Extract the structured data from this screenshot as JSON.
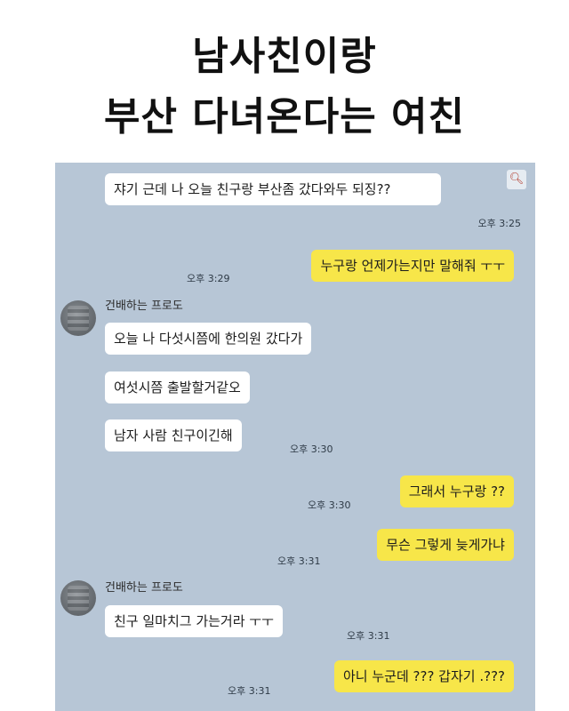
{
  "headline": {
    "line1": "남사친이랑",
    "line2": "부산 다녀온다는 여친"
  },
  "chat": {
    "search_icon": "search-icon",
    "messages": [
      {
        "side": "left",
        "text": "쟈기 근데 나 오늘 친구랑 부산좀 갔다와두 되징??",
        "time": "오후 3:25"
      },
      {
        "side": "right",
        "text": "누구랑 언제가는지만 말해줘 ㅜㅜ",
        "time": "오후 3:29"
      },
      {
        "side": "left",
        "sender": "건배하는 프로도",
        "text": "오늘 나 다섯시쯤에 한의원 갔다가"
      },
      {
        "side": "left",
        "text": "여섯시쯤 출발할거같오"
      },
      {
        "side": "left",
        "text": "남자 사람 친구이긴해",
        "time": "오후 3:30"
      },
      {
        "side": "right",
        "text": "그래서 누구랑 ??",
        "time": "오후 3:30"
      },
      {
        "side": "right",
        "text": "무슨 그렇게 늦게가냐",
        "time": "오후 3:31"
      },
      {
        "side": "left",
        "sender": "건배하는 프로도",
        "text": "친구 일마치그 가는거라 ㅜㅜ",
        "time": "오후 3:31"
      },
      {
        "side": "right",
        "text": "아니 누군데 ??? 갑자기 .???",
        "time": "오후 3:31"
      }
    ]
  }
}
